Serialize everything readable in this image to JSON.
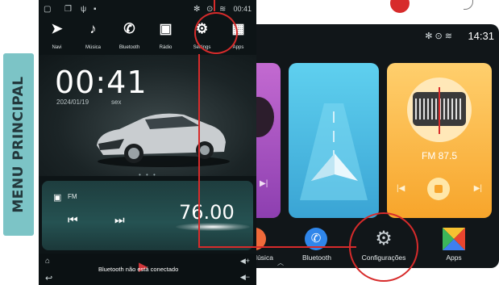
{
  "side_label": "MENU PRINCIPAL",
  "vertical": {
    "status": {
      "time": "00:41"
    },
    "nav": [
      {
        "label": "Navi",
        "icon": "navigation-arrow-icon",
        "glyph": "➤"
      },
      {
        "label": "Música",
        "icon": "music-note-icon",
        "glyph": "♪"
      },
      {
        "label": "Bluetooth",
        "icon": "phone-icon",
        "glyph": "✆"
      },
      {
        "label": "Rádio",
        "icon": "radio-icon",
        "glyph": "▣"
      },
      {
        "label": "Settings",
        "icon": "gear-icon",
        "glyph": "⚙"
      },
      {
        "label": "Apps",
        "icon": "apps-grid-icon",
        "glyph": "▦"
      }
    ],
    "clock": "00:41",
    "date": "2024/01/19",
    "weekday": "sex",
    "radio": {
      "label": "FM",
      "frequency": "76.00",
      "prev_glyph": "⏮",
      "next_glyph": "⏭"
    },
    "bottom_status": "Bluetooth não está conectado"
  },
  "horizontal": {
    "time": "14:31",
    "status_icons": "✻  ⊙  ≋",
    "radio_card": {
      "frequency": "FM 87.5"
    },
    "dock": [
      {
        "label": "Música",
        "icon": "music-icon"
      },
      {
        "label": "Bluetooth",
        "icon": "bluetooth-phone-icon"
      },
      {
        "label": "Configurações",
        "icon": "settings-gear-icon"
      },
      {
        "label": "Apps",
        "icon": "apps-icon"
      }
    ]
  },
  "colors": {
    "highlight": "#d72b2b",
    "side_label_bg": "#7cc4c6",
    "nav_card": "#4cbfe6",
    "radio_card": "#fbb949",
    "music_card": "#a955c4"
  }
}
